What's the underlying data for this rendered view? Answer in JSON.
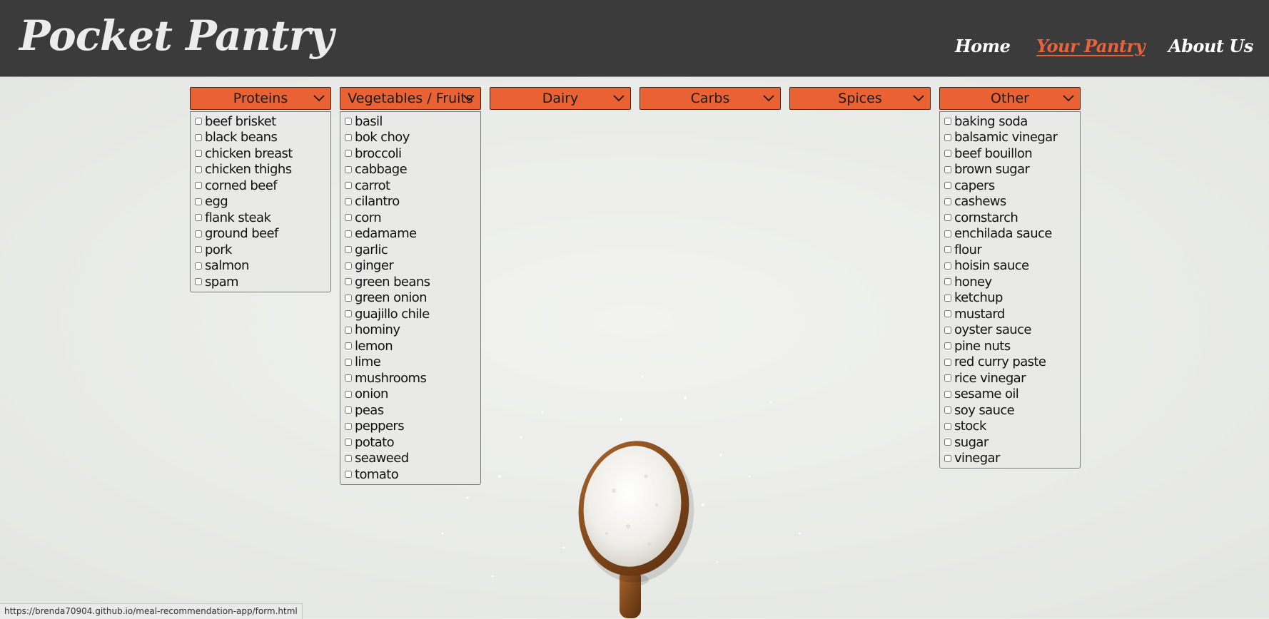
{
  "header": {
    "logo": "Pocket Pantry",
    "nav": [
      {
        "label": "Home",
        "active": false
      },
      {
        "label": "Your Pantry",
        "active": true
      },
      {
        "label": "About Us",
        "active": false
      }
    ]
  },
  "categories": [
    {
      "name": "Proteins",
      "items": [
        "beef brisket",
        "black beans",
        "chicken breast",
        "chicken thighs",
        "corned beef",
        "egg",
        "flank steak",
        "ground beef",
        "pork",
        "salmon",
        "spam"
      ]
    },
    {
      "name": "Vegetables / Fruits",
      "items": [
        "basil",
        "bok choy",
        "broccoli",
        "cabbage",
        "carrot",
        "cilantro",
        "corn",
        "edamame",
        "garlic",
        "ginger",
        "green beans",
        "green onion",
        "guajillo chile",
        "hominy",
        "lemon",
        "lime",
        "mushrooms",
        "onion",
        "peas",
        "peppers",
        "potato",
        "seaweed",
        "tomato"
      ]
    },
    {
      "name": "Dairy",
      "items": []
    },
    {
      "name": "Carbs",
      "items": []
    },
    {
      "name": "Spices",
      "items": []
    },
    {
      "name": "Other",
      "items": [
        "baking soda",
        "balsamic vinegar",
        "beef bouillon",
        "brown sugar",
        "capers",
        "cashews",
        "cornstarch",
        "enchilada sauce",
        "flour",
        "hoisin sauce",
        "honey",
        "ketchup",
        "mustard",
        "oyster sauce",
        "pine nuts",
        "red curry paste",
        "rice vinegar",
        "sesame oil",
        "soy sauce",
        "stock",
        "sugar",
        "vinegar"
      ]
    }
  ],
  "status_bar": {
    "url": "https://brenda70904.github.io/meal-recommendation-app/form.html"
  },
  "colors": {
    "header_bg": "#3b3b3b",
    "accent": "#ea6234",
    "active_link": "#e8623a",
    "page_bg": "#eceeeb"
  }
}
